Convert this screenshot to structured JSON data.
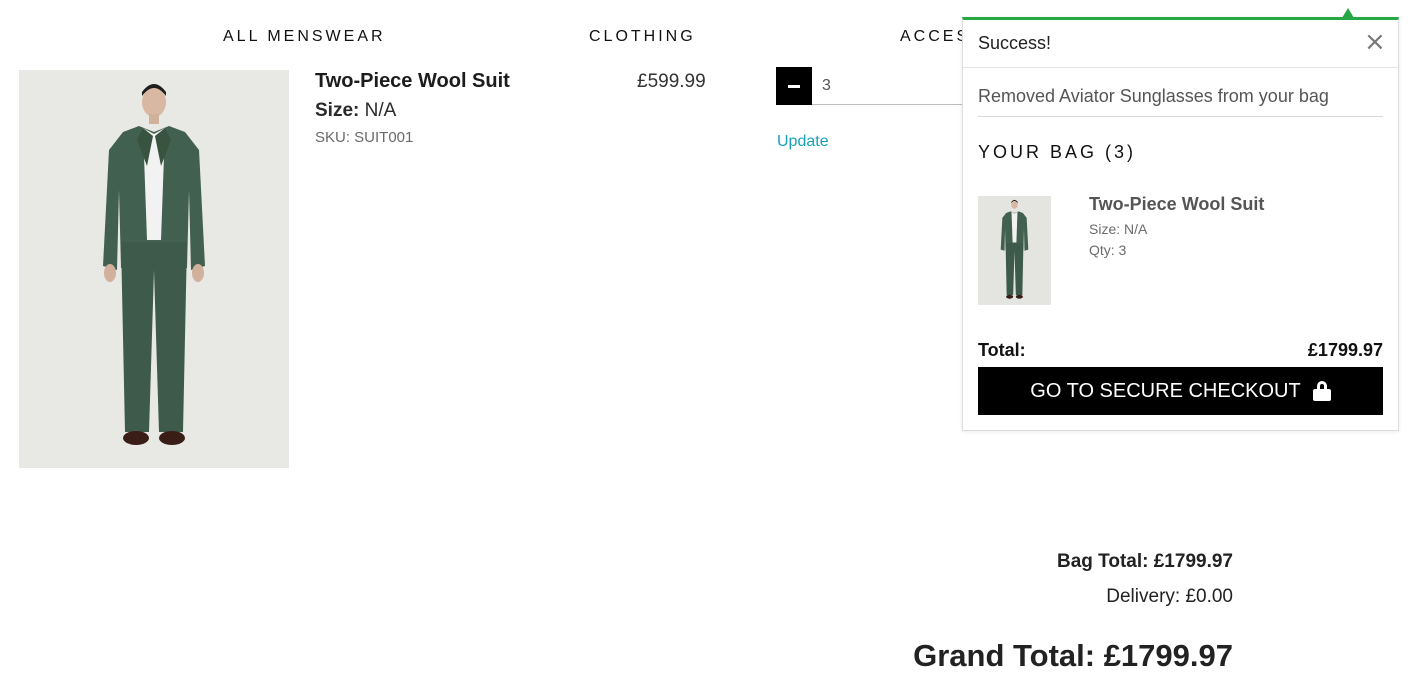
{
  "nav": {
    "items": [
      "ALL MENSWEAR",
      "CLOTHING",
      "ACCES"
    ]
  },
  "item": {
    "name": "Two-Piece Wool Suit",
    "size_label": "Size:",
    "size_value": "N/A",
    "sku": "SKU: SUIT001",
    "price": "£599.99",
    "qty_value": "3",
    "update_label": "Update"
  },
  "totals": {
    "bag_total": "Bag Total: £1799.97",
    "delivery": "Delivery: £0.00",
    "grand_total": "Grand Total: £1799.97"
  },
  "toast": {
    "title": "Success!",
    "close_glyph": "×",
    "message": "Removed Aviator Sunglasses from your bag",
    "bag_heading": "YOUR BAG (3)",
    "bag_item": {
      "name": "Two-Piece Wool Suit",
      "size": "Size: N/A",
      "qty": "Qty: 3"
    },
    "total_label": "Total:",
    "total_value": "£1799.97",
    "checkout_label": "GO TO SECURE CHECKOUT",
    "checkout_icon": "lock-icon"
  },
  "colors": {
    "success_accent": "#28a745",
    "link": "#17a2b8",
    "button_bg": "#000000",
    "suit": "#3f5a4c"
  }
}
